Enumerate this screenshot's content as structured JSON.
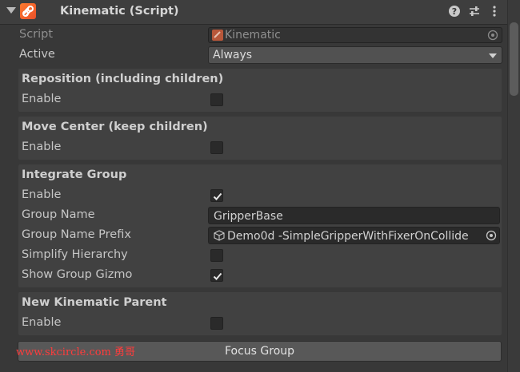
{
  "component": {
    "title": "Kinematic (Script)",
    "icons": [
      "foldout-arrow-icon",
      "script-icon",
      "help-icon",
      "presets-icon",
      "context-menu-icon"
    ]
  },
  "script_row": {
    "label": "Script",
    "value": "Kinematic"
  },
  "active_row": {
    "label": "Active",
    "value": "Always"
  },
  "sections": {
    "reposition": {
      "title": "Reposition (including children)",
      "enable_label": "Enable",
      "enabled": false
    },
    "move_center": {
      "title": "Move Center (keep children)",
      "enable_label": "Enable",
      "enabled": false
    },
    "integrate_group": {
      "title": "Integrate Group",
      "enable_label": "Enable",
      "enabled": true,
      "group_name_label": "Group Name",
      "group_name_value": "GripperBase",
      "prefix_label": "Group Name Prefix",
      "prefix_value": "Demo0d -SimpleGripperWithFixerOnCollide",
      "simplify_label": "Simplify Hierarchy",
      "simplify": false,
      "gizmo_label": "Show Group Gizmo",
      "gizmo": true
    },
    "new_parent": {
      "title": "New Kinematic Parent",
      "enable_label": "Enable",
      "enabled": false
    }
  },
  "focus_button": {
    "label": "Focus Group"
  },
  "watermark": "www.skcircle.com 勇哥",
  "colors": {
    "background": "#383838",
    "section": "#414141",
    "field": "#2a2a2a",
    "script_icon": "#ff6a2a"
  }
}
